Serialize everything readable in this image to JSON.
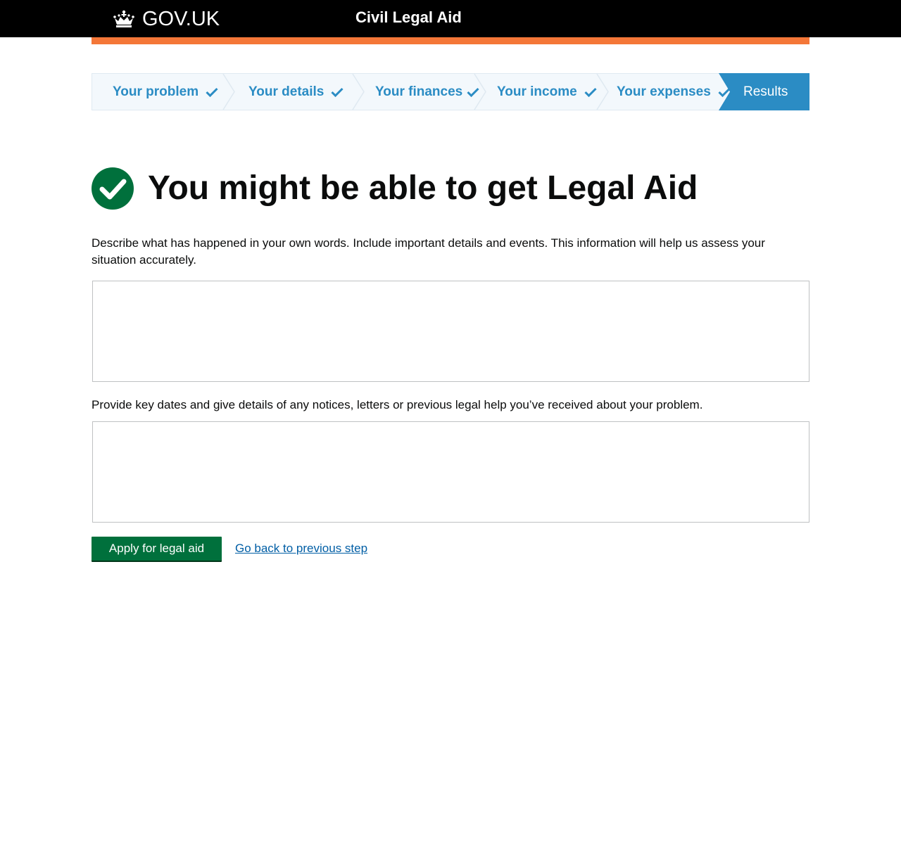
{
  "header": {
    "logo_text": "GOV.UK",
    "logo_icon": "crown-icon",
    "service_name": "Civil Legal Aid",
    "stripe_color": "#f47738"
  },
  "steps": {
    "items": [
      {
        "label": "Your problem",
        "status": "complete"
      },
      {
        "label": "Your details",
        "status": "complete"
      },
      {
        "label": "Your finances",
        "status": "complete"
      },
      {
        "label": "Your income",
        "status": "complete"
      },
      {
        "label": "Your expenses",
        "status": "complete"
      }
    ],
    "current": {
      "label": "Results",
      "status": "current"
    },
    "complete_color": "#2b8cc4",
    "current_bg": "#2b8cc4"
  },
  "result": {
    "icon": "check-circle-icon",
    "icon_color": "#00703c",
    "title": "You might be able to get Legal Aid"
  },
  "form": {
    "describe_label": "Describe what has happened in your own words. Include important details and events. This information will help us assess your situation accurately.",
    "describe_value": "",
    "dates_label": "Provide key dates and give details of any notices, letters or previous legal help you’ve received about your problem.",
    "dates_value": "",
    "apply_button": "Apply for legal aid",
    "back_link": "Go back to previous step",
    "button_color": "#00703c",
    "link_color": "#005ea5"
  }
}
